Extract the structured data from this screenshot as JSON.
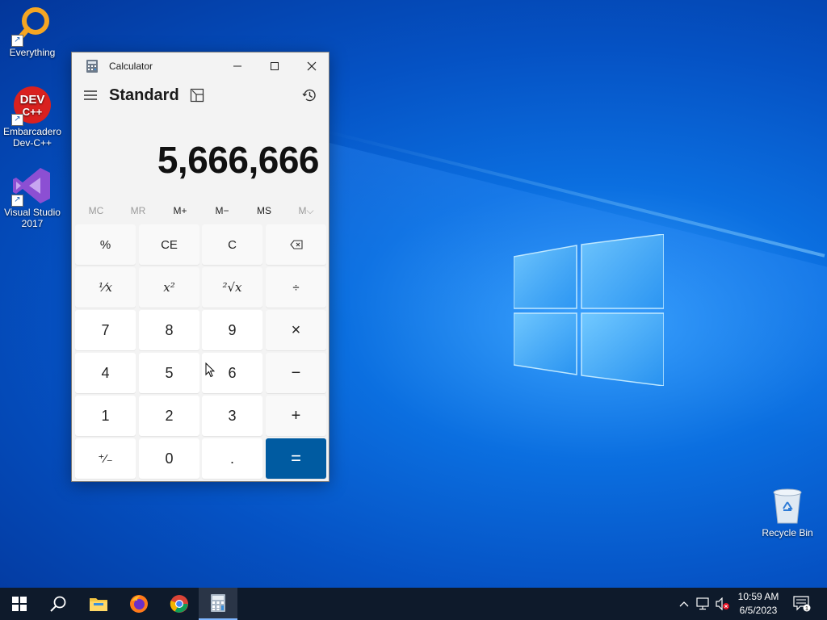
{
  "desktop": {
    "icons": [
      {
        "label": "Everything",
        "icon": "everything-icon"
      },
      {
        "label": "Embarcadero Dev-C++",
        "icon": "devcpp-icon",
        "logo_text": "DEV C++"
      },
      {
        "label": "Visual Studio 2017",
        "icon": "visual-studio-icon"
      }
    ],
    "recycle_bin": {
      "label": "Recycle Bin",
      "icon": "recycle-bin-icon"
    }
  },
  "calculator": {
    "window_title": "Calculator",
    "mode": "Standard",
    "display": "5,666,666",
    "memory_buttons": [
      {
        "label": "MC",
        "enabled": false
      },
      {
        "label": "MR",
        "enabled": false
      },
      {
        "label": "M+",
        "enabled": true
      },
      {
        "label": "M−",
        "enabled": true
      },
      {
        "label": "MS",
        "enabled": true
      },
      {
        "label": "M⌵",
        "enabled": false
      }
    ],
    "keys": {
      "percent": "%",
      "ce": "CE",
      "c": "C",
      "backspace": "⌫",
      "reciprocal": "¹⁄x",
      "square": "x²",
      "sqrt": "²√x",
      "divide": "÷",
      "seven": "7",
      "eight": "8",
      "nine": "9",
      "multiply": "×",
      "four": "4",
      "five": "5",
      "six": "6",
      "minus": "−",
      "one": "1",
      "two": "2",
      "three": "3",
      "plus": "+",
      "negate": "⁺⁄₋",
      "zero": "0",
      "decimal": ".",
      "equals": "="
    },
    "colors": {
      "equals_bg": "#005ba1",
      "window_bg": "#f3f3f3"
    }
  },
  "taskbar": {
    "apps": [
      "start-icon",
      "search-icon",
      "file-explorer-icon",
      "firefox-icon",
      "chrome-icon",
      "calculator-icon"
    ],
    "active_app": "calculator-icon",
    "tray_icons": [
      "chevron-up-icon",
      "network-icon",
      "volume-muted-icon"
    ],
    "time": "10:59 AM",
    "date": "6/5/2023",
    "notification_count": "1"
  }
}
